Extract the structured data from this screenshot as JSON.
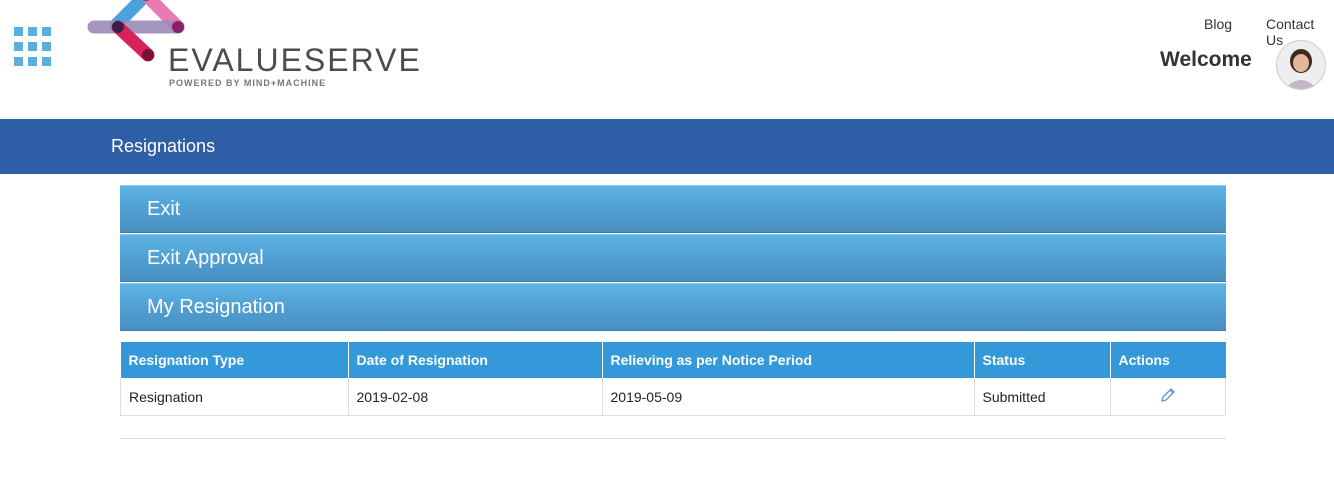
{
  "brand": {
    "name": "EVALUESERVE",
    "tagline": "POWERED BY MIND+MACHINE",
    "colors": {
      "pink": "#e05a8f",
      "blue": "#4aa3df",
      "purple": "#8a6fa8",
      "crimson": "#c0174b"
    }
  },
  "header": {
    "links": {
      "blog": "Blog",
      "contact": "Contact Us"
    },
    "welcome": "Welcome"
  },
  "page": {
    "title": "Resignations"
  },
  "accordion": {
    "items": [
      {
        "label": "Exit"
      },
      {
        "label": "Exit Approval"
      },
      {
        "label": "My Resignation"
      }
    ]
  },
  "table": {
    "columns": [
      "Resignation Type",
      "Date of Resignation",
      "Relieving as per Notice Period",
      "Status",
      "Actions"
    ],
    "rows": [
      {
        "type": "Resignation",
        "date": "2019-02-08",
        "relieving": "2019-05-09",
        "status": "Submitted",
        "action_icon": "edit-pencil-icon"
      }
    ]
  },
  "colors": {
    "title_band": "#2e5ea6",
    "panel": "#4e9ccf",
    "table_header": "#3399d9"
  }
}
